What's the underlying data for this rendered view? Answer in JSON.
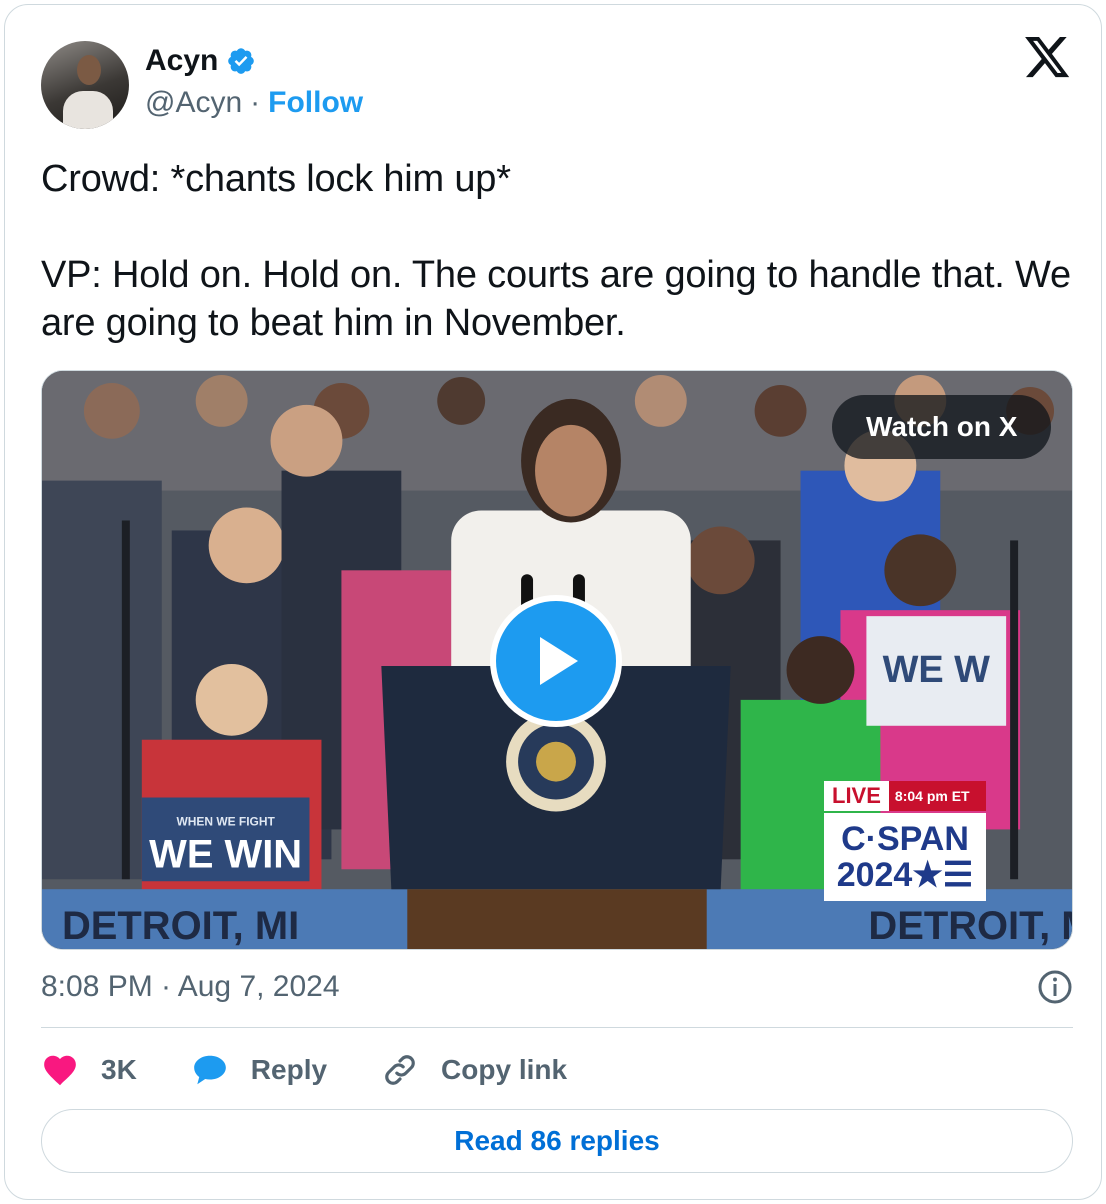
{
  "author": {
    "name": "Acyn",
    "handle": "@Acyn",
    "separator": "·",
    "follow_label": "Follow",
    "verified_icon": "verified-badge-icon"
  },
  "tweet": {
    "text": "Crowd: *chants lock him up*\n\nVP: Hold on. Hold on. The courts are going to handle that. We are going to beat him in November."
  },
  "media": {
    "watch_label": "Watch on X",
    "overlay": {
      "live": "LIVE",
      "time": "8:04 pm ET",
      "network": "C·SPAN",
      "year": "2024★☰"
    },
    "banner_left": "DETROIT, MI",
    "banner_right": "DETROIT, MI"
  },
  "meta": {
    "timestamp": "8:08 PM · Aug 7, 2024"
  },
  "actions": {
    "likes": "3K",
    "reply_label": "Reply",
    "copy_label": "Copy link"
  },
  "footer": {
    "read_replies": "Read 86 replies"
  },
  "colors": {
    "accent": "#1d9bf0",
    "link": "#006fd6",
    "like": "#f91880",
    "muted": "#536471"
  }
}
